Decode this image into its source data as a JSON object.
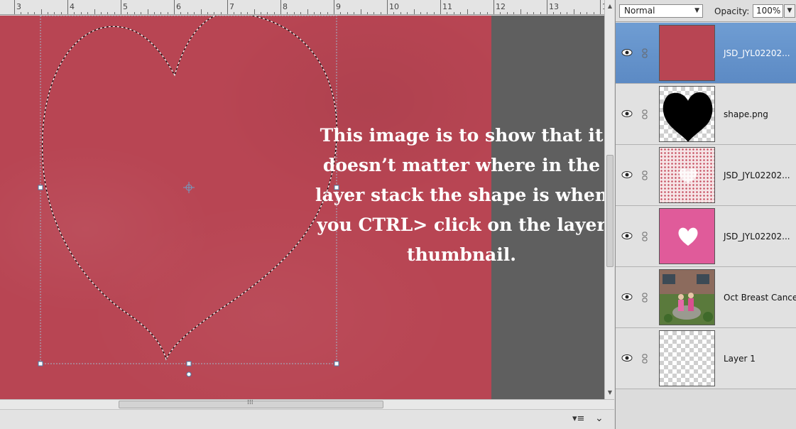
{
  "ruler": {
    "labels": [
      "3",
      "4",
      "5",
      "6",
      "7",
      "8",
      "9",
      "10",
      "11",
      "12",
      "13",
      "1"
    ]
  },
  "canvas": {
    "overlay_text": "This image is to show that it\ndoesn’t matter where in the\nlayer stack the shape is when\nyou CTRL> click on the layer\nthumbnail.",
    "paper_color": "#b84553",
    "pasteboard_color": "#5f5f5f"
  },
  "layers_panel": {
    "blend_mode": "Normal",
    "opacity_label": "Opacity:",
    "opacity_value": "100%",
    "layers": [
      {
        "name": "JSD_JYL02202...",
        "thumb": "red-paper",
        "selected": true
      },
      {
        "name": "shape.png",
        "thumb": "black-heart",
        "selected": false
      },
      {
        "name": "JSD_JYL02202...",
        "thumb": "dotted-paper",
        "selected": false
      },
      {
        "name": "JSD_JYL02202...",
        "thumb": "pink-paper-heart-cutout",
        "selected": false
      },
      {
        "name": "Oct Breast Cancer...",
        "thumb": "photo",
        "selected": false
      },
      {
        "name": "Layer 1",
        "thumb": "transparent",
        "selected": false
      }
    ]
  },
  "icons": {
    "eye": "eye-icon",
    "link": "chain-link-icon",
    "panel_menu": "panel-menu-icon",
    "collapse": "chevron-down-icon"
  },
  "colors": {
    "selected_layer": "#6f9dd3",
    "panel_bg": "#dcdcdc"
  }
}
